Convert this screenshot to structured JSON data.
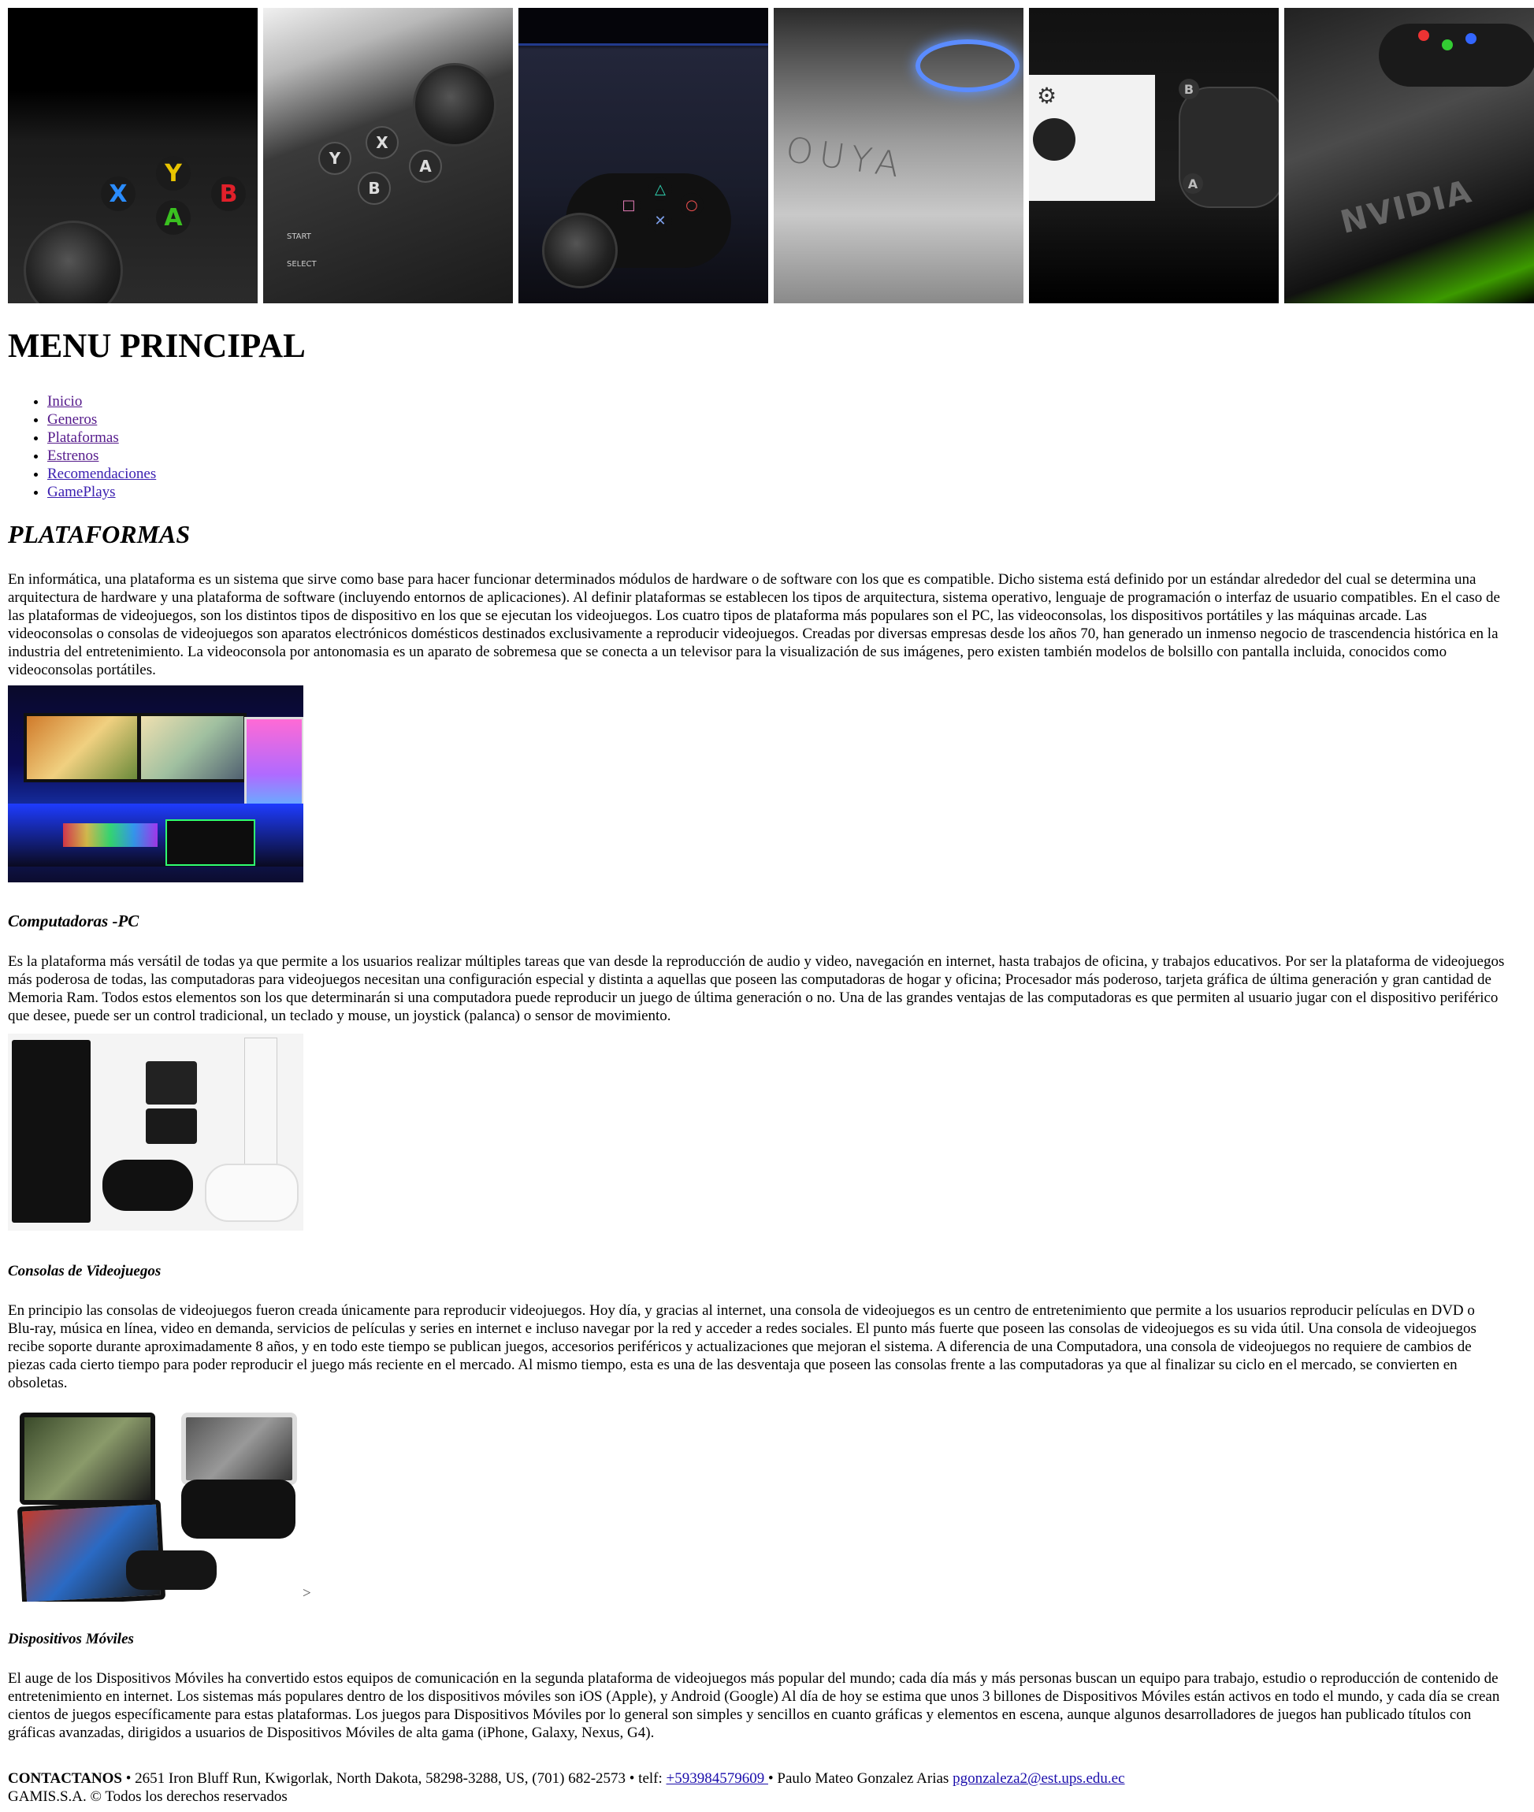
{
  "banner": {
    "panels": [
      {
        "name": "xbox-controller",
        "labels": [
          "Y",
          "X",
          "B",
          "A"
        ]
      },
      {
        "name": "steam-controller",
        "labels": [
          "Y",
          "X",
          "A",
          "B",
          "START",
          "SELECT"
        ]
      },
      {
        "name": "ps4-controller",
        "labels": []
      },
      {
        "name": "ouya-console",
        "labels": [
          "OUYA"
        ]
      },
      {
        "name": "steam-machine",
        "labels": [
          "B",
          "A"
        ]
      },
      {
        "name": "nvidia-shield",
        "labels": [
          "NVIDIA"
        ]
      }
    ]
  },
  "menu": {
    "title": "MENU PRINCIPAL",
    "items": [
      "Inicio",
      "Generos",
      "Plataformas",
      "Estrenos",
      "Recomendaciones",
      "GamePlays"
    ]
  },
  "section": {
    "title": "PLATAFORMAS",
    "intro": "En informática, una plataforma es un sistema que sirve como base para hacer funcionar determinados módulos de hardware o de software con los que es compatible. Dicho sistema está definido por un estándar alrededor del cual se determina una arquitectura de hardware y una plataforma de software (incluyendo entornos de aplicaciones). Al definir plataformas se establecen los tipos de arquitectura, sistema operativo, lenguaje de programación o interfaz de usuario compatibles. En el caso de las plataformas de videojuegos, son los distintos tipos de dispositivo en los que se ejecutan los videojuegos. Los cuatro tipos de plataforma más populares son el PC, las videoconsolas, los dispositivos portátiles y las máquinas arcade. Las videoconsolas o consolas de videojuegos son aparatos electrónicos domésticos destinados exclusivamente a reproducir videojuegos. Creadas por diversas empresas desde los años 70, han generado un inmenso negocio de trascendencia histórica en la industria del entretenimiento. La videoconsola por antonomasia es un aparato de sobremesa que se conecta a un televisor para la visualización de sus imágenes, pero existen también modelos de bolsillo con pantalla incluida, conocidos como videoconsolas portátiles."
  },
  "pc": {
    "title": "Computadoras -PC",
    "text": "Es la plataforma más versátil de todas ya que permite a los usuarios realizar múltiples tareas que van desde la reproducción de audio y video, navegación en internet, hasta trabajos de oficina, y trabajos educativos. Por ser la plataforma de videojuegos más poderosa de todas, las computadoras para videojuegos necesitan una configuración especial y distinta a aquellas que poseen las computadoras de hogar y oficina; Procesador más poderoso, tarjeta gráfica de última generación y gran cantidad de Memoria Ram. Todos estos elementos son los que determinarán si una computadora puede reproducir un juego de última generación o no. Una de las grandes ventajas de las computadoras es que permiten al usuario jugar con el dispositivo periférico que desee, puede ser un control tradicional, un teclado y mouse, un joystick (palanca) o sensor de movimiento."
  },
  "consoles": {
    "title": "Consolas de Videojuegos",
    "text": "En principio las consolas de videojuegos fueron creada únicamente para reproducir videojuegos. Hoy día, y gracias al internet, una consola de videojuegos es un centro de entretenimiento que permite a los usuarios reproducir películas en DVD o Blu-ray, música en línea, video en demanda, servicios de películas y series en internet e incluso navegar por la red y acceder a redes sociales. El punto más fuerte que poseen las consolas de videojuegos es su vida útil. Una consola de videojuegos recibe soporte durante aproximadamente 8 años, y en todo este tiempo se publican juegos, accesorios periféricos y actualizaciones que mejoran el sistema. A diferencia de una Computadora, una consola de videojuegos no requiere de cambios de piezas cada cierto tiempo para poder reproducir el juego más reciente en el mercado. Al mismo tiempo, esta es una de las desventaja que poseen las consolas frente a las computadoras ya que al finalizar su ciclo en el mercado, se convierten en obsoletas."
  },
  "mobile": {
    "title": "Dispositivos Móviles",
    "stray_char": ">",
    "text": "El auge de los Dispositivos Móviles ha convertido estos equipos de comunicación en la segunda plataforma de videojuegos más popular del mundo; cada día más y más personas buscan un equipo para trabajo, estudio o reproducción de contenido de entretenimiento en internet. Los sistemas más populares dentro de los dispositivos móviles son iOS (Apple), y Android (Google) Al día de hoy se estima que unos 3 billones de Dispositivos Móviles están activos en todo el mundo, y cada día se crean cientos de juegos específicamente para estas plataformas. Los juegos para Dispositivos Móviles por lo general son simples y sencillos en cuanto gráficas y elementos en escena, aunque algunos desarrolladores de juegos han publicado títulos con gráficas avanzadas, dirigidos a usuarios de Dispositivos Móviles de alta gama (iPhone, Galaxy, Nexus, G4)."
  },
  "footer": {
    "contact_label": "CONTACTANOS",
    "address": " • 2651 Iron Bluff Run, Kwigorlak, North Dakota, 58298-3288, US, (701) 682-2573 • telf: ",
    "phone": "+593984579609 ",
    "name": " • Paulo Mateo Gonzalez Arias ",
    "email": "pgonzaleza2@est.ups.edu.ec ",
    "copyright": "GAMIS.S.A. © Todos los derechos reservados"
  }
}
